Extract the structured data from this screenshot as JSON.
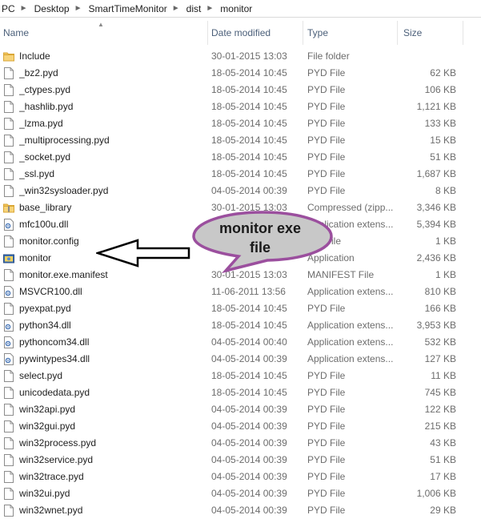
{
  "breadcrumb": [
    "PC",
    "Desktop",
    "SmartTimeMonitor",
    "dist",
    "monitor"
  ],
  "columns": {
    "name": "Name",
    "date": "Date modified",
    "type": "Type",
    "size": "Size"
  },
  "files": [
    {
      "name": "Include",
      "date": "30-01-2015 13:03",
      "type": "File folder",
      "size": "",
      "icon": "folder-icon"
    },
    {
      "name": "_bz2.pyd",
      "date": "18-05-2014 10:45",
      "type": "PYD File",
      "size": "62 KB",
      "icon": "file-icon"
    },
    {
      "name": "_ctypes.pyd",
      "date": "18-05-2014 10:45",
      "type": "PYD File",
      "size": "106 KB",
      "icon": "file-icon"
    },
    {
      "name": "_hashlib.pyd",
      "date": "18-05-2014 10:45",
      "type": "PYD File",
      "size": "1,121 KB",
      "icon": "file-icon"
    },
    {
      "name": "_lzma.pyd",
      "date": "18-05-2014 10:45",
      "type": "PYD File",
      "size": "133 KB",
      "icon": "file-icon"
    },
    {
      "name": "_multiprocessing.pyd",
      "date": "18-05-2014 10:45",
      "type": "PYD File",
      "size": "15 KB",
      "icon": "file-icon"
    },
    {
      "name": "_socket.pyd",
      "date": "18-05-2014 10:45",
      "type": "PYD File",
      "size": "51 KB",
      "icon": "file-icon"
    },
    {
      "name": "_ssl.pyd",
      "date": "18-05-2014 10:45",
      "type": "PYD File",
      "size": "1,687 KB",
      "icon": "file-icon"
    },
    {
      "name": "_win32sysloader.pyd",
      "date": "04-05-2014 00:39",
      "type": "PYD File",
      "size": "8 KB",
      "icon": "file-icon"
    },
    {
      "name": "base_library",
      "date": "30-01-2015 13:03",
      "type": "Compressed (zipp...",
      "size": "3,346 KB",
      "icon": "zip-folder-icon"
    },
    {
      "name": "mfc100u.dll",
      "date": "",
      "type": "Application extens...",
      "size": "5,394 KB",
      "icon": "dll-icon"
    },
    {
      "name": "monitor.config",
      "date": "",
      "type": "...G File",
      "size": "1 KB",
      "icon": "file-icon"
    },
    {
      "name": "monitor",
      "date": "",
      "type": "Application",
      "size": "2,436 KB",
      "icon": "exe-icon"
    },
    {
      "name": "monitor.exe.manifest",
      "date": "30-01-2015 13:03",
      "type": "MANIFEST File",
      "size": "1 KB",
      "icon": "file-icon"
    },
    {
      "name": "MSVCR100.dll",
      "date": "11-06-2011 13:56",
      "type": "Application extens...",
      "size": "810 KB",
      "icon": "dll-icon"
    },
    {
      "name": "pyexpat.pyd",
      "date": "18-05-2014 10:45",
      "type": "PYD File",
      "size": "166 KB",
      "icon": "file-icon"
    },
    {
      "name": "python34.dll",
      "date": "18-05-2014 10:45",
      "type": "Application extens...",
      "size": "3,953 KB",
      "icon": "dll-icon"
    },
    {
      "name": "pythoncom34.dll",
      "date": "04-05-2014 00:40",
      "type": "Application extens...",
      "size": "532 KB",
      "icon": "dll-icon"
    },
    {
      "name": "pywintypes34.dll",
      "date": "04-05-2014 00:39",
      "type": "Application extens...",
      "size": "127 KB",
      "icon": "dll-icon"
    },
    {
      "name": "select.pyd",
      "date": "18-05-2014 10:45",
      "type": "PYD File",
      "size": "11 KB",
      "icon": "file-icon"
    },
    {
      "name": "unicodedata.pyd",
      "date": "18-05-2014 10:45",
      "type": "PYD File",
      "size": "745 KB",
      "icon": "file-icon"
    },
    {
      "name": "win32api.pyd",
      "date": "04-05-2014 00:39",
      "type": "PYD File",
      "size": "122 KB",
      "icon": "file-icon"
    },
    {
      "name": "win32gui.pyd",
      "date": "04-05-2014 00:39",
      "type": "PYD File",
      "size": "215 KB",
      "icon": "file-icon"
    },
    {
      "name": "win32process.pyd",
      "date": "04-05-2014 00:39",
      "type": "PYD File",
      "size": "43 KB",
      "icon": "file-icon"
    },
    {
      "name": "win32service.pyd",
      "date": "04-05-2014 00:39",
      "type": "PYD File",
      "size": "51 KB",
      "icon": "file-icon"
    },
    {
      "name": "win32trace.pyd",
      "date": "04-05-2014 00:39",
      "type": "PYD File",
      "size": "17 KB",
      "icon": "file-icon"
    },
    {
      "name": "win32ui.pyd",
      "date": "04-05-2014 00:39",
      "type": "PYD File",
      "size": "1,006 KB",
      "icon": "file-icon"
    },
    {
      "name": "win32wnet.pyd",
      "date": "04-05-2014 00:39",
      "type": "PYD File",
      "size": "29 KB",
      "icon": "file-icon"
    }
  ],
  "annotation": {
    "text_line1": "monitor exe",
    "text_line2": "file",
    "bubble_color": "#c8c8c8",
    "bubble_border": "#9b4f9e",
    "arrow_color": "#000000"
  },
  "colors": {
    "header_text": "#4c607a",
    "secondary_text": "#6d6d6d",
    "folder": "#e8b84a"
  }
}
